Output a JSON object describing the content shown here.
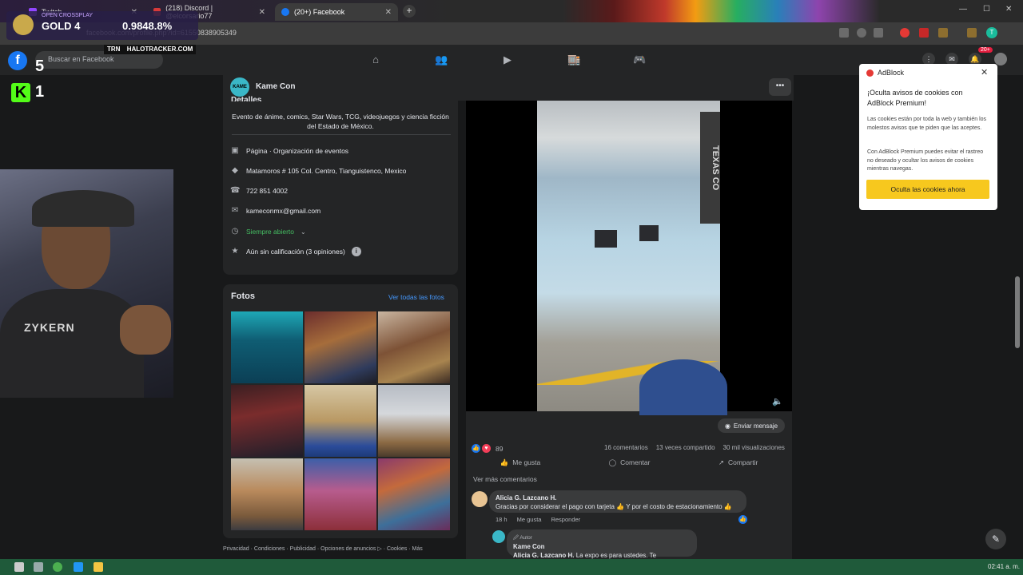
{
  "browser": {
    "tabs": [
      {
        "label": "Twitch",
        "favicon_color": "#9146ff"
      },
      {
        "label": "(218) Discord | @elcorsario77",
        "favicon_color": "#d63a3a"
      },
      {
        "label": "(20+) Facebook",
        "favicon_color": "#1877f2"
      }
    ],
    "url": "facebook.com/profile.php?id=61550838905349"
  },
  "stream_overlay": {
    "crossplay": "OPEN CROSSPLAY",
    "rank": "GOLD 4",
    "percent": "0.9848.8%",
    "trn_tag": "TRN",
    "tracker": "HALOTRACKER.COM",
    "score_f": "5",
    "score_k": "1"
  },
  "facebook": {
    "search_placeholder": "Buscar en Facebook",
    "notif_count": "20+",
    "page_name": "Kame Con",
    "page_avatar_text": "KAME CON",
    "details": {
      "heading": "Detalles",
      "description": "Evento de ánime, comics, Star Wars, TCG, videojuegos y ciencia ficción del Estado de México.",
      "category": "Página · Organización de eventos",
      "address": "Matamoros # 105 Col. Centro, Tianguistenco, Mexico",
      "phone": "722 851 4002",
      "email": "kameconmx@gmail.com",
      "hours": "Siempre abierto",
      "rating": "Aún sin calificación (3 opiniones)"
    },
    "photos": {
      "title": "Fotos",
      "see_all": "Ver todas las fotos"
    },
    "footer": "Privacidad · Condiciones · Publicidad · Opciones de anuncios ▷ · Cookies · Más",
    "post": {
      "send_message": "Enviar mensaje",
      "reaction_count": "89",
      "comments": "16 comentarios",
      "shares": "13 veces compartido",
      "views": "30 mil visualizaciones",
      "actions": {
        "like": "Me gusta",
        "comment": "Comentar",
        "share": "Compartir"
      },
      "more_comments": "Ver más comentarios",
      "comment1": {
        "author": "Alicia G. Lazcano H.",
        "text": "Gracias por considerar el pago con tarjeta 👍 Y por el costo de estacionamiento 👍",
        "time": "18 h",
        "like": "Me gusta",
        "reply": "Responder"
      },
      "reply1": {
        "badge": "🖉 Autor",
        "author": "Kame Con",
        "mention": "Alicia G. Lazcano H.",
        "text": " La expo es para ustedes. Te esperamos!!"
      }
    },
    "video_sign": "TEXAS CO"
  },
  "adblock": {
    "name": "AdBlock",
    "title": "¡Oculta avisos de cookies con AdBlock Premium!",
    "p1": "Las cookies están por toda la web y también los molestos avisos que te piden que las aceptes.",
    "p2": "Con AdBlock Premium puedes evitar el rastreo no deseado y ocultar los avisos de cookies mientras navegas.",
    "button": "Oculta las cookies ahora"
  },
  "webcam": {
    "shirt_text": "ZYKERN"
  },
  "taskbar": {
    "clock": "02:41 a. m."
  }
}
